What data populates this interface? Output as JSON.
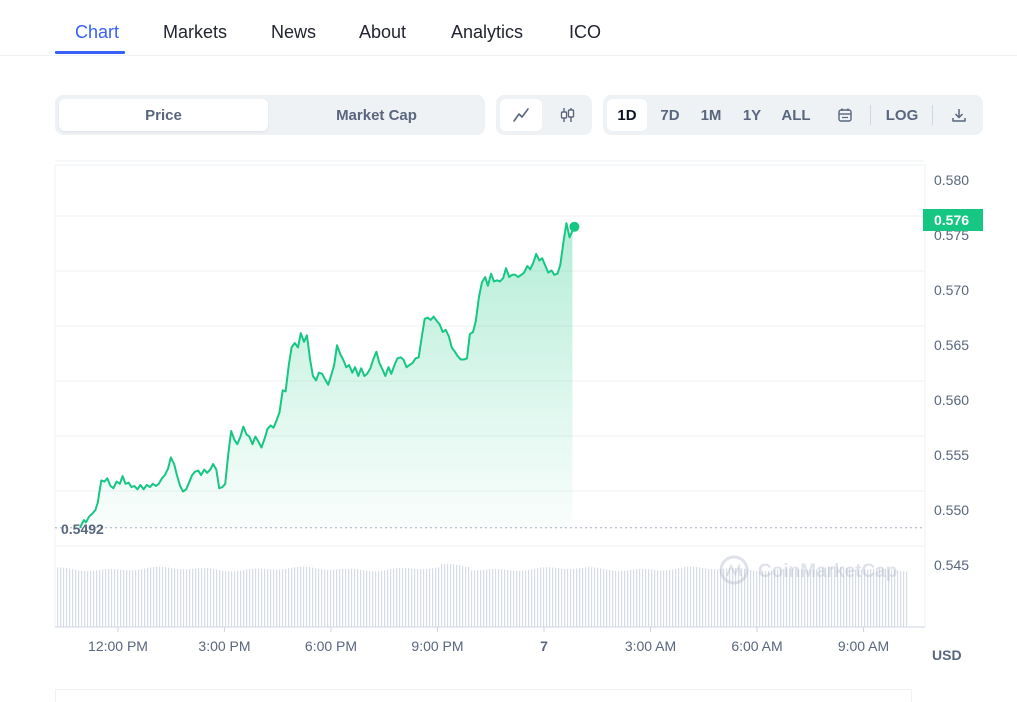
{
  "nav": {
    "tabs": [
      {
        "label": "Chart",
        "active": true
      },
      {
        "label": "Markets"
      },
      {
        "label": "News"
      },
      {
        "label": "About"
      },
      {
        "label": "Analytics"
      },
      {
        "label": "ICO"
      }
    ]
  },
  "toolbar": {
    "metric_options": [
      "Price",
      "Market Cap"
    ],
    "metric_selected": "Price",
    "chart_styles": [
      "line-chart-icon",
      "candlestick-icon"
    ],
    "chart_style_selected": "line-chart-icon",
    "ranges": [
      "1D",
      "7D",
      "1M",
      "1Y",
      "ALL"
    ],
    "range_selected": "1D",
    "calendar_icon": "calendar-icon",
    "log_label": "LOG",
    "download_icon": "download-icon"
  },
  "colors": {
    "accent": "#3861fb",
    "line": "#16c784",
    "area_top": "#16c784",
    "axis_text": "#58667e",
    "grid": "#eff2f5"
  },
  "chart_data": {
    "type": "area",
    "title": "",
    "xlabel": "",
    "ylabel": "USD",
    "ylim": [
      0.54,
      0.58
    ],
    "y_ticks": [
      "0.580",
      "0.575",
      "0.570",
      "0.565",
      "0.560",
      "0.555",
      "0.550",
      "0.545"
    ],
    "x_ticks": [
      "12:00 PM",
      "3:00 PM",
      "6:00 PM",
      "9:00 PM",
      "7",
      "3:00 AM",
      "6:00 AM",
      "9:00 AM"
    ],
    "open_price_label": "0.5492",
    "open_price": 0.5492,
    "current_price_label": "0.576",
    "current_price": 0.5763,
    "watermark": "CoinMarketCap",
    "grid": true,
    "volume_bars": true,
    "series": [
      {
        "values": [
          [
            10.93,
            0.5492
          ],
          [
            10.99,
            0.5496
          ],
          [
            11.04,
            0.5499
          ],
          [
            11.1,
            0.5497
          ],
          [
            11.18,
            0.5502
          ],
          [
            11.28,
            0.5505
          ],
          [
            11.36,
            0.5508
          ],
          [
            11.43,
            0.5515
          ],
          [
            11.48,
            0.5525
          ],
          [
            11.53,
            0.5535
          ],
          [
            11.62,
            0.5534
          ],
          [
            11.7,
            0.5537
          ],
          [
            11.79,
            0.553
          ],
          [
            11.87,
            0.5528
          ],
          [
            11.96,
            0.5534
          ],
          [
            12.05,
            0.5532
          ],
          [
            12.13,
            0.5539
          ],
          [
            12.21,
            0.5532
          ],
          [
            12.3,
            0.5533
          ],
          [
            12.38,
            0.5529
          ],
          [
            12.46,
            0.553
          ],
          [
            12.55,
            0.5527
          ],
          [
            12.63,
            0.5531
          ],
          [
            12.72,
            0.5527
          ],
          [
            12.81,
            0.5531
          ],
          [
            12.9,
            0.5529
          ],
          [
            12.98,
            0.5532
          ],
          [
            13.07,
            0.553
          ],
          [
            13.15,
            0.5532
          ],
          [
            13.24,
            0.5537
          ],
          [
            13.32,
            0.554
          ],
          [
            13.41,
            0.5546
          ],
          [
            13.49,
            0.5556
          ],
          [
            13.58,
            0.555
          ],
          [
            13.66,
            0.554
          ],
          [
            13.75,
            0.553
          ],
          [
            13.83,
            0.5525
          ],
          [
            13.92,
            0.5527
          ],
          [
            14.0,
            0.5533
          ],
          [
            14.09,
            0.554
          ],
          [
            14.17,
            0.5543
          ],
          [
            14.26,
            0.5544
          ],
          [
            14.34,
            0.554
          ],
          [
            14.43,
            0.5545
          ],
          [
            14.51,
            0.5542
          ],
          [
            14.6,
            0.5545
          ],
          [
            14.68,
            0.555
          ],
          [
            14.77,
            0.5545
          ],
          [
            14.85,
            0.5528
          ],
          [
            14.94,
            0.5529
          ],
          [
            15.02,
            0.5532
          ],
          [
            15.11,
            0.556
          ],
          [
            15.19,
            0.558
          ],
          [
            15.28,
            0.5572
          ],
          [
            15.36,
            0.5568
          ],
          [
            15.45,
            0.5575
          ],
          [
            15.53,
            0.5584
          ],
          [
            15.62,
            0.5577
          ],
          [
            15.7,
            0.5575
          ],
          [
            15.79,
            0.5568
          ],
          [
            15.87,
            0.5575
          ],
          [
            15.96,
            0.557
          ],
          [
            16.04,
            0.5565
          ],
          [
            16.13,
            0.5573
          ],
          [
            16.21,
            0.5582
          ],
          [
            16.3,
            0.5585
          ],
          [
            16.38,
            0.5583
          ],
          [
            16.47,
            0.559
          ],
          [
            16.55,
            0.5597
          ],
          [
            16.64,
            0.5617
          ],
          [
            16.72,
            0.5616
          ],
          [
            16.81,
            0.564
          ],
          [
            16.89,
            0.5656
          ],
          [
            16.98,
            0.566
          ],
          [
            17.07,
            0.5656
          ],
          [
            17.15,
            0.5669
          ],
          [
            17.24,
            0.5661
          ],
          [
            17.32,
            0.5667
          ],
          [
            17.41,
            0.5645
          ],
          [
            17.49,
            0.563
          ],
          [
            17.58,
            0.5626
          ],
          [
            17.66,
            0.5633
          ],
          [
            17.75,
            0.5632
          ],
          [
            17.83,
            0.5627
          ],
          [
            17.92,
            0.5622
          ],
          [
            18.0,
            0.563
          ],
          [
            18.09,
            0.564
          ],
          [
            18.17,
            0.5658
          ],
          [
            18.26,
            0.565
          ],
          [
            18.34,
            0.5645
          ],
          [
            18.43,
            0.5638
          ],
          [
            18.51,
            0.564
          ],
          [
            18.6,
            0.5633
          ],
          [
            18.68,
            0.5638
          ],
          [
            18.77,
            0.563
          ],
          [
            18.85,
            0.5637
          ],
          [
            18.94,
            0.563
          ],
          [
            19.02,
            0.5632
          ],
          [
            19.11,
            0.5637
          ],
          [
            19.19,
            0.5645
          ],
          [
            19.28,
            0.5652
          ],
          [
            19.36,
            0.5642
          ],
          [
            19.45,
            0.5636
          ],
          [
            19.53,
            0.563
          ],
          [
            19.62,
            0.5638
          ],
          [
            19.7,
            0.5632
          ],
          [
            19.79,
            0.564
          ],
          [
            19.87,
            0.5646
          ],
          [
            19.96,
            0.5647
          ],
          [
            20.04,
            0.5645
          ],
          [
            20.13,
            0.5638
          ],
          [
            20.21,
            0.564
          ],
          [
            20.3,
            0.5642
          ],
          [
            20.38,
            0.5646
          ],
          [
            20.47,
            0.5647
          ],
          [
            20.55,
            0.5664
          ],
          [
            20.64,
            0.5682
          ],
          [
            20.72,
            0.5683
          ],
          [
            20.81,
            0.5681
          ],
          [
            20.89,
            0.5684
          ],
          [
            20.98,
            0.568
          ],
          [
            21.06,
            0.5677
          ],
          [
            21.15,
            0.567
          ],
          [
            21.23,
            0.5672
          ],
          [
            21.32,
            0.5666
          ],
          [
            21.4,
            0.5656
          ],
          [
            21.49,
            0.5652
          ],
          [
            21.57,
            0.5648
          ],
          [
            21.66,
            0.5645
          ],
          [
            21.74,
            0.5645
          ],
          [
            21.83,
            0.5646
          ],
          [
            21.91,
            0.5668
          ],
          [
            22.0,
            0.567
          ],
          [
            22.08,
            0.568
          ],
          [
            22.17,
            0.5702
          ],
          [
            22.25,
            0.5715
          ],
          [
            22.34,
            0.572
          ],
          [
            22.42,
            0.5712
          ],
          [
            22.51,
            0.5723
          ],
          [
            22.59,
            0.5716
          ],
          [
            22.68,
            0.5717
          ],
          [
            22.76,
            0.5716
          ],
          [
            22.85,
            0.5719
          ],
          [
            22.93,
            0.5728
          ],
          [
            23.02,
            0.572
          ],
          [
            23.1,
            0.5722
          ],
          [
            23.19,
            0.5722
          ],
          [
            23.27,
            0.572
          ],
          [
            23.36,
            0.5722
          ],
          [
            23.44,
            0.5724
          ],
          [
            23.53,
            0.573
          ],
          [
            23.61,
            0.5727
          ],
          [
            23.7,
            0.5733
          ],
          [
            23.78,
            0.5741
          ],
          [
            23.87,
            0.5735
          ],
          [
            23.95,
            0.5737
          ],
          [
            24.04,
            0.573
          ],
          [
            24.12,
            0.5724
          ],
          [
            24.21,
            0.5726
          ],
          [
            24.29,
            0.5722
          ],
          [
            24.38,
            0.5723
          ],
          [
            24.46,
            0.5731
          ],
          [
            24.55,
            0.5752
          ],
          [
            24.63,
            0.5769
          ],
          [
            24.72,
            0.5756
          ],
          [
            24.8,
            0.5762
          ]
        ]
      }
    ]
  }
}
